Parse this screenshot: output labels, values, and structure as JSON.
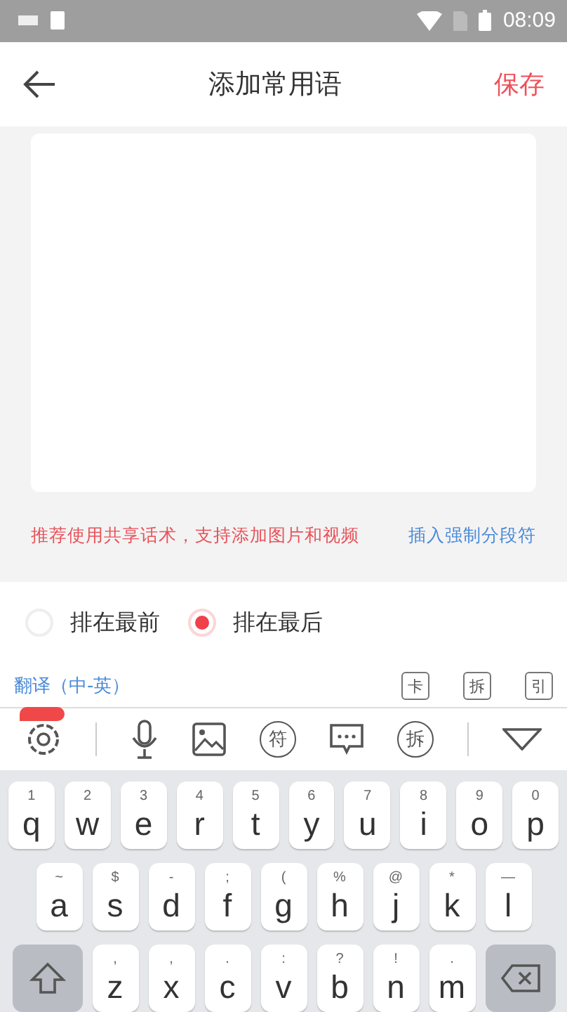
{
  "status_bar": {
    "time": "08:09"
  },
  "header": {
    "title": "添加常用语",
    "save": "保存"
  },
  "hint": {
    "text": "推荐使用共享话术，支持添加图片和视频",
    "link": "插入强制分段符"
  },
  "sort_options": [
    {
      "label": "排在最前",
      "selected": false
    },
    {
      "label": "排在最后",
      "selected": true
    }
  ],
  "translate": {
    "label": "翻译（中-英）",
    "tools": [
      "卡",
      "拆",
      "引"
    ]
  },
  "keyboard_toolbar": {
    "symbol_key": "符",
    "split_key": "拆"
  },
  "keyboard": {
    "rows": [
      [
        {
          "main": "q",
          "sub": "1"
        },
        {
          "main": "w",
          "sub": "2"
        },
        {
          "main": "e",
          "sub": "3"
        },
        {
          "main": "r",
          "sub": "4"
        },
        {
          "main": "t",
          "sub": "5"
        },
        {
          "main": "y",
          "sub": "6"
        },
        {
          "main": "u",
          "sub": "7"
        },
        {
          "main": "i",
          "sub": "8"
        },
        {
          "main": "o",
          "sub": "9"
        },
        {
          "main": "p",
          "sub": "0"
        }
      ],
      [
        {
          "main": "a",
          "sub": "~"
        },
        {
          "main": "s",
          "sub": "$"
        },
        {
          "main": "d",
          "sub": "-"
        },
        {
          "main": "f",
          "sub": ";"
        },
        {
          "main": "g",
          "sub": "("
        },
        {
          "main": "h",
          "sub": "%"
        },
        {
          "main": "j",
          "sub": "@"
        },
        {
          "main": "k",
          "sub": "*"
        },
        {
          "main": "l",
          "sub": "—"
        }
      ],
      [
        {
          "main": "z",
          "sub": ","
        },
        {
          "main": "x",
          "sub": ","
        },
        {
          "main": "c",
          "sub": "."
        },
        {
          "main": "v",
          "sub": ":"
        },
        {
          "main": "b",
          "sub": "?"
        },
        {
          "main": "n",
          "sub": "!"
        },
        {
          "main": "m",
          "sub": "."
        }
      ]
    ]
  }
}
